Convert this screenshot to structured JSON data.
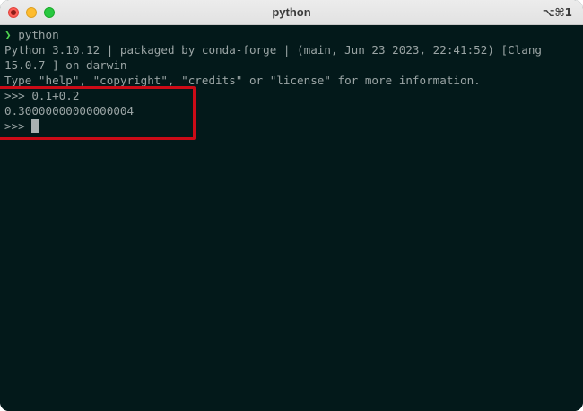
{
  "window": {
    "title": "python",
    "shortcut": "⌥⌘1",
    "traffic_lights": {
      "close": "#fe5f57",
      "minimize": "#febc2e",
      "maximize": "#28c840"
    }
  },
  "terminal": {
    "background": "#03191a",
    "prompt_symbol": "❯",
    "command": "python",
    "lines": [
      "Python 3.10.12 | packaged by conda-forge | (main, Jun 23 2023, 22:41:52) [Clang",
      "15.0.7 ] on darwin",
      "Type \"help\", \"copyright\", \"credits\" or \"license\" for more information.",
      ">>> 0.1+0.2",
      "0.30000000000000004",
      ">>> "
    ]
  },
  "annotation": {
    "color": "#cc0b17",
    "shape": "rectangle"
  }
}
